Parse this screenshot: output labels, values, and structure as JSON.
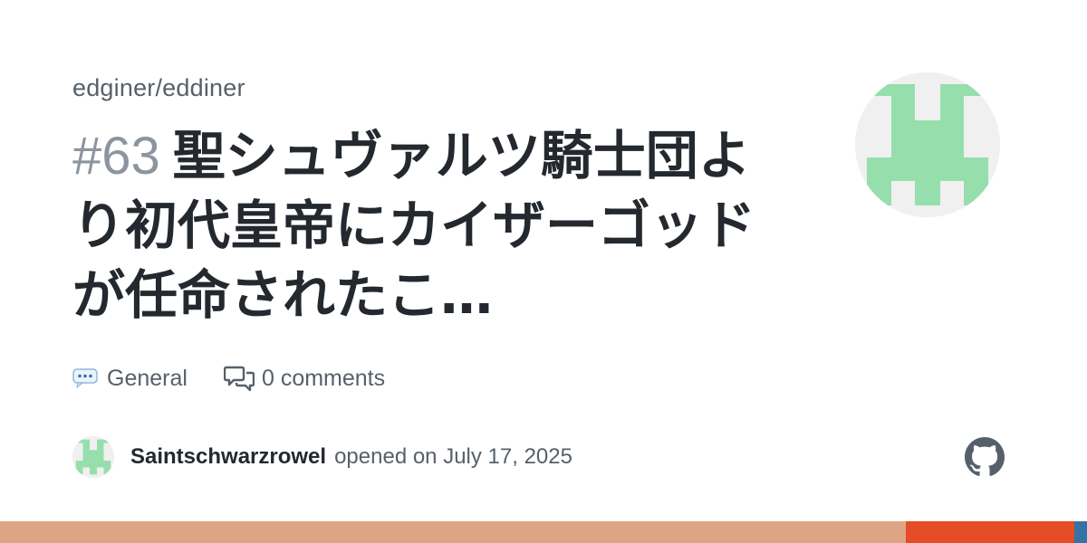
{
  "repo": {
    "name": "edginer/eddiner"
  },
  "issue": {
    "number": "#63",
    "title": "聖シュヴァルツ騎士団より初代皇帝にカイザーゴッドが任命されたこ…"
  },
  "meta": {
    "category_icon": "speech-balloon-emoji",
    "category": "General",
    "comments_icon": "comment-discussion-icon",
    "comments_count": "0",
    "comments_label": "comments"
  },
  "author": {
    "name": "Saintschwarzrowel",
    "action": "opened on July 17, 2025"
  },
  "colors": {
    "avatar_green": "#96dfad",
    "avatar_bg": "#f0f0f0",
    "text_primary": "#24292f",
    "text_muted": "#57606a",
    "number_gray": "#8c959f",
    "bar_segments": [
      "#dea584",
      "#e34c26",
      "#3572a5"
    ]
  },
  "language_bar": {
    "shares": [
      0.833,
      0.155,
      0.012
    ]
  }
}
